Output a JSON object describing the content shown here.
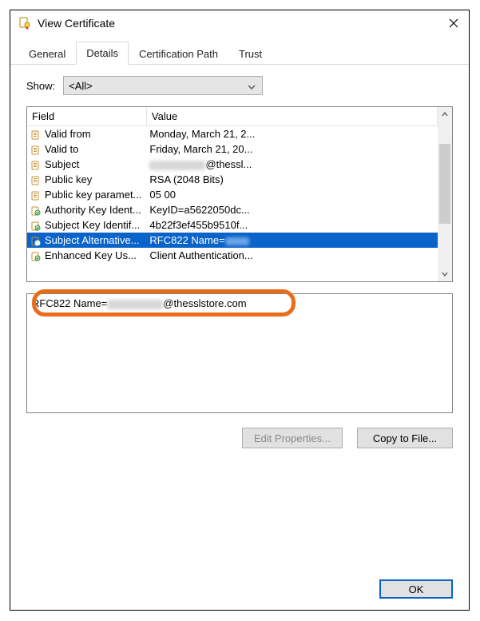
{
  "window": {
    "title": "View Certificate"
  },
  "tabs": {
    "general": "General",
    "details": "Details",
    "certpath": "Certification Path",
    "trust": "Trust"
  },
  "show": {
    "label": "Show:",
    "value": "<All>"
  },
  "table": {
    "headers": {
      "field": "Field",
      "value": "Value"
    },
    "rows": [
      {
        "icon": "doc",
        "field": "Valid from",
        "value": "Monday, March 21, 2..."
      },
      {
        "icon": "doc",
        "field": "Valid to",
        "value": "Friday, March 21, 20..."
      },
      {
        "icon": "doc",
        "field": "Subject",
        "value_prefix": "",
        "value_suffix": "@thessl...",
        "blurred": true
      },
      {
        "icon": "doc",
        "field": "Public key",
        "value": "RSA (2048 Bits)"
      },
      {
        "icon": "doc",
        "field": "Public key paramet...",
        "value": "05 00"
      },
      {
        "icon": "ext",
        "field": "Authority Key Ident...",
        "value": "KeyID=a5622050dc..."
      },
      {
        "icon": "ext",
        "field": "Subject Key Identif...",
        "value": "4b22f3ef455b9510f..."
      },
      {
        "icon": "ext",
        "field": "Subject Alternative...",
        "value_prefix": "RFC822 Name=",
        "value_suffix": "",
        "blurred_trail": true,
        "selected": true
      },
      {
        "icon": "ext",
        "field": "Enhanced Key Us...",
        "value": "Client Authentication..."
      }
    ]
  },
  "detail": {
    "prefix": "RFC822 Name=",
    "suffix": "@thesslstore.com"
  },
  "buttons": {
    "edit": "Edit Properties...",
    "copy": "Copy to File...",
    "ok": "OK"
  }
}
